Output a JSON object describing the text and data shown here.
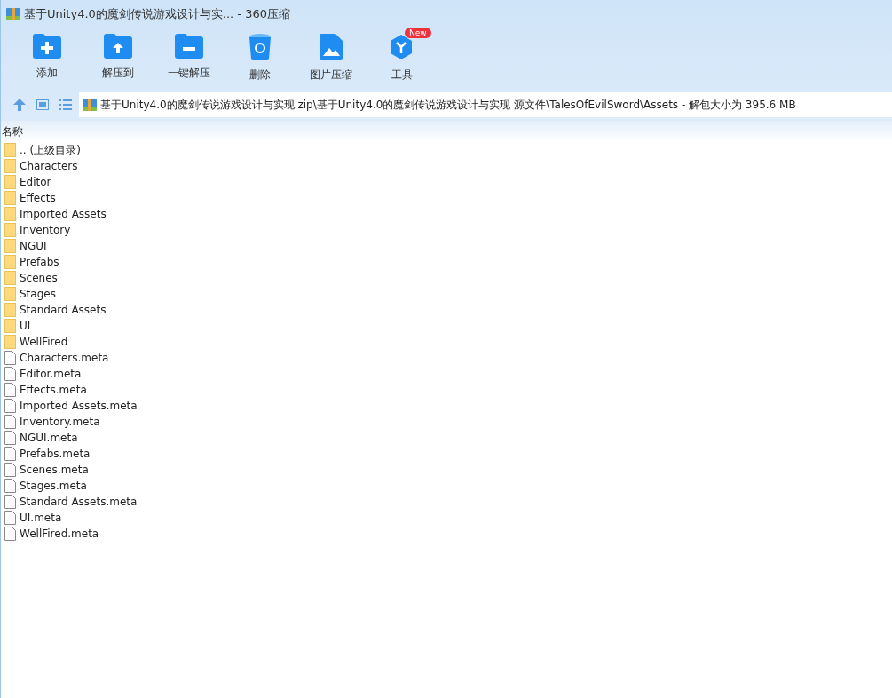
{
  "window": {
    "title": "基于Unity4.0的魔剑传说游戏设计与实... - 360压缩"
  },
  "toolbar": [
    {
      "kind": "add",
      "label": "添加"
    },
    {
      "kind": "extract-to",
      "label": "解压到"
    },
    {
      "kind": "extract",
      "label": "一键解压"
    },
    {
      "kind": "delete",
      "label": "删除"
    },
    {
      "kind": "image",
      "label": "图片压缩"
    },
    {
      "kind": "tools",
      "label": "工具",
      "badge": "New"
    }
  ],
  "address_bar": {
    "path": "基于Unity4.0的魔剑传说游戏设计与实现.zip\\基于Unity4.0的魔剑传说游戏设计与实现 源文件\\TalesOfEvilSword\\Assets - 解包大小为 395.6 MB"
  },
  "table": {
    "columns": [
      "名称"
    ],
    "rows": [
      {
        "kind": "folder",
        "name": ".. (上级目录)"
      },
      {
        "kind": "folder",
        "name": "Characters"
      },
      {
        "kind": "folder",
        "name": "Editor"
      },
      {
        "kind": "folder",
        "name": "Effects"
      },
      {
        "kind": "folder",
        "name": "Imported Assets"
      },
      {
        "kind": "folder",
        "name": "Inventory"
      },
      {
        "kind": "folder",
        "name": "NGUI"
      },
      {
        "kind": "folder",
        "name": "Prefabs"
      },
      {
        "kind": "folder",
        "name": "Scenes"
      },
      {
        "kind": "folder",
        "name": "Stages"
      },
      {
        "kind": "folder",
        "name": "Standard Assets"
      },
      {
        "kind": "folder",
        "name": "UI"
      },
      {
        "kind": "folder",
        "name": "WellFired"
      },
      {
        "kind": "file",
        "name": "Characters.meta"
      },
      {
        "kind": "file",
        "name": "Editor.meta"
      },
      {
        "kind": "file",
        "name": "Effects.meta"
      },
      {
        "kind": "file",
        "name": "Imported Assets.meta"
      },
      {
        "kind": "file",
        "name": "Inventory.meta"
      },
      {
        "kind": "file",
        "name": "NGUI.meta"
      },
      {
        "kind": "file",
        "name": "Prefabs.meta"
      },
      {
        "kind": "file",
        "name": "Scenes.meta"
      },
      {
        "kind": "file",
        "name": "Stages.meta"
      },
      {
        "kind": "file",
        "name": "Standard Assets.meta"
      },
      {
        "kind": "file",
        "name": "UI.meta"
      },
      {
        "kind": "file",
        "name": "WellFired.meta"
      }
    ]
  }
}
